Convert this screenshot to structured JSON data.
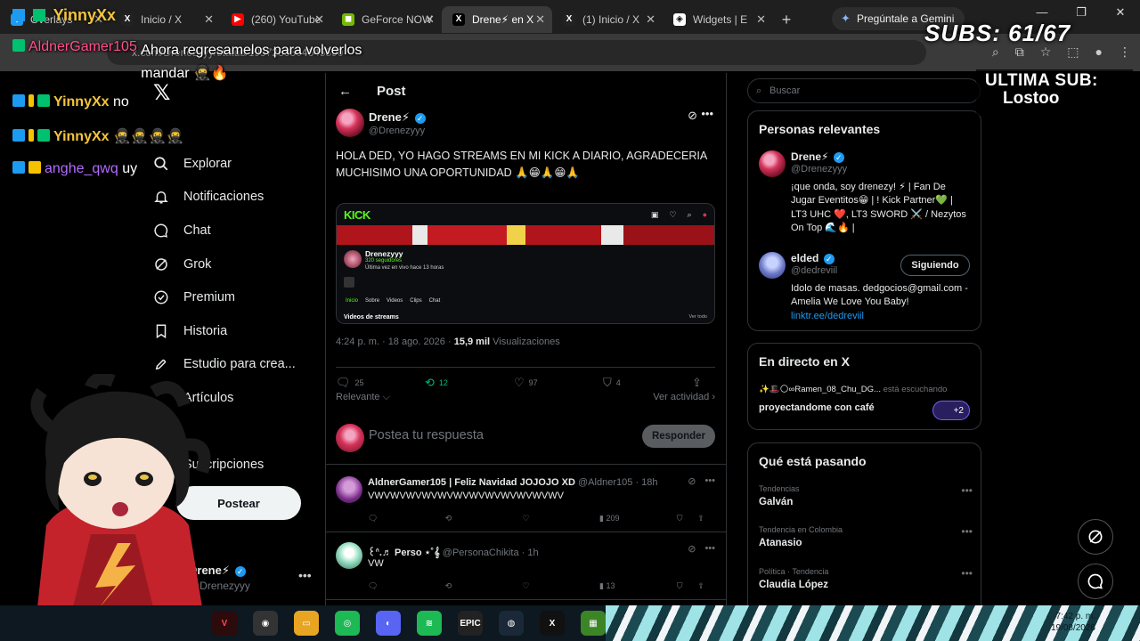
{
  "browser": {
    "tabs": [
      {
        "label": "Overlays",
        "icon": "cube-icon",
        "color": "#1d9bf0",
        "active": false
      },
      {
        "label": "Inicio / X",
        "icon": "x-icon",
        "color": "#000000",
        "active": false
      },
      {
        "label": "(260) YouTube",
        "icon": "youtube-icon",
        "color": "#ff0000",
        "active": false
      },
      {
        "label": "GeForce NOW",
        "icon": "geforce-icon",
        "color": "#76b900",
        "active": false
      },
      {
        "label": "Drene⚡ en X",
        "icon": "x-icon",
        "color": "#000000",
        "active": true
      },
      {
        "label": "(1) Inicio / X",
        "icon": "x-icon",
        "color": "#000000",
        "active": false
      },
      {
        "label": "Widgets | E",
        "icon": "widgets-icon",
        "color": "#ffffff",
        "active": false
      }
    ],
    "gemini_label": "Pregúntale a Gemini",
    "url": "x.com/Drenezyyy/status/1957253504645590"
  },
  "x_nav": {
    "items": [
      {
        "label": "Explorar",
        "icon": "search-icon"
      },
      {
        "label": "Notificaciones",
        "icon": "bell-icon"
      },
      {
        "label": "Chat",
        "icon": "chat-icon"
      },
      {
        "label": "Grok",
        "icon": "grok-icon"
      },
      {
        "label": "Premium",
        "icon": "premium-icon"
      },
      {
        "label": "Historia",
        "icon": "bookmark-icon"
      },
      {
        "label": "Estudio para crea...",
        "icon": "rocket-icon"
      },
      {
        "label": "Artículos",
        "icon": "article-icon"
      },
      {
        "label": "",
        "icon": "blank-icon"
      },
      {
        "label": "Suscripciones",
        "icon": "subs-icon"
      }
    ],
    "post_button": "Postear",
    "me_name": "Drene⚡",
    "me_handle": "@Drenezyyy"
  },
  "main": {
    "header_title": "Post",
    "tweet": {
      "author": "Drene⚡",
      "handle": "@Drenezyyy",
      "text": "HOLA DED, YO HAGO STREAMS EN MI KICK A DIARIO, AGRADECERIA MUCHISIMO UNA OPORTUNIDAD 🙏😁🙏😁🙏",
      "meta_time": "4:24 p. m. · 18 ago. 2026 · ",
      "meta_views": "15,9 mil",
      "meta_views_label": " Visualizaciones",
      "replies": "25",
      "retweets": "12",
      "likes": "97",
      "bookmarks": "4",
      "sort": "Relevante ⌵",
      "activity": "Ver actividad ›"
    },
    "media": {
      "logo": "KICK",
      "channel": "Drenezyyy",
      "followers": "320 seguidores",
      "last_live": "Última vez en vivo hace 13 horas",
      "tabs": [
        "Inicio",
        "Sobre",
        "Videos",
        "Clips",
        "Chat"
      ],
      "videos_title": "Videos de streams",
      "ver_todo": "Ver todo"
    },
    "reply_placeholder": "Postea tu respuesta",
    "reply_button": "Responder",
    "replies": [
      {
        "name": "AldnerGamer105 | Feliz Navidad JOJOJO XD",
        "handle": "@Aldner105 · 18h",
        "text": "VWVWVWVWVWVWVWVWVWVWVWVWV",
        "views": "209"
      },
      {
        "name": "꒰ᐢ.♬ Perso ⋆˚𝄞",
        "handle": "@PersonaChikita · 1h",
        "text": "VW",
        "views": "13"
      }
    ]
  },
  "right": {
    "search_placeholder": "Buscar",
    "relevant_title": "Personas relevantes",
    "people": [
      {
        "name": "Drene⚡",
        "handle": "@Drenezyyy",
        "bio": "¡que onda, soy drenezy! ⚡ | Fan De Jugar Eventitos😁 | ! Kick Partner💚 | LT3 UHC ❤️, LT3 SWORD ⚔️ / Nezytos On Top 🌊🔥 |",
        "link": ""
      },
      {
        "name": "elded",
        "handle": "@dedreviil",
        "bio": "Idolo de masas. dedgocios@gmail.com - Amelia We Love You Baby!",
        "link": "linktr.ee/dedreviil",
        "follow_label": "Siguiendo"
      }
    ],
    "live_title": "En directo en X",
    "live_host": "✨🎩🌕∞Ramen_08_Chu_DG...",
    "live_status": " está escuchando",
    "live_topic": "proyectandome con café",
    "live_count": "+2",
    "trending_title": "Qué está pasando",
    "trends": [
      {
        "category": "Tendencias",
        "name": "Galván"
      },
      {
        "category": "Tendencia en Colombia",
        "name": "Atanasio"
      },
      {
        "category": "Política · Tendencia",
        "name": "Claudia López"
      }
    ]
  },
  "overlay": {
    "subs": "SUBS: 61/67",
    "ultima_title": "ULTIMA SUB:",
    "ultima_name": "Lostoo",
    "chat": [
      {
        "user": "AldnerGamer105",
        "text": "Ahora regresamelos para volverlos mandar 🥷🔥",
        "color": "#ff4f8b"
      },
      {
        "user": "YinnyXx",
        "text": "no",
        "color": "#f3c53c"
      },
      {
        "user": "YinnyXx",
        "text": "🥷🥷🥷🥷",
        "color": "#f3c53c"
      },
      {
        "user": "anghe_qwq",
        "text": "uy",
        "color": "#b36bff"
      }
    ],
    "top_user": "YinnyXx"
  },
  "taskbar": {
    "time": "7:42 p. m.",
    "date": "19/08/2026"
  }
}
